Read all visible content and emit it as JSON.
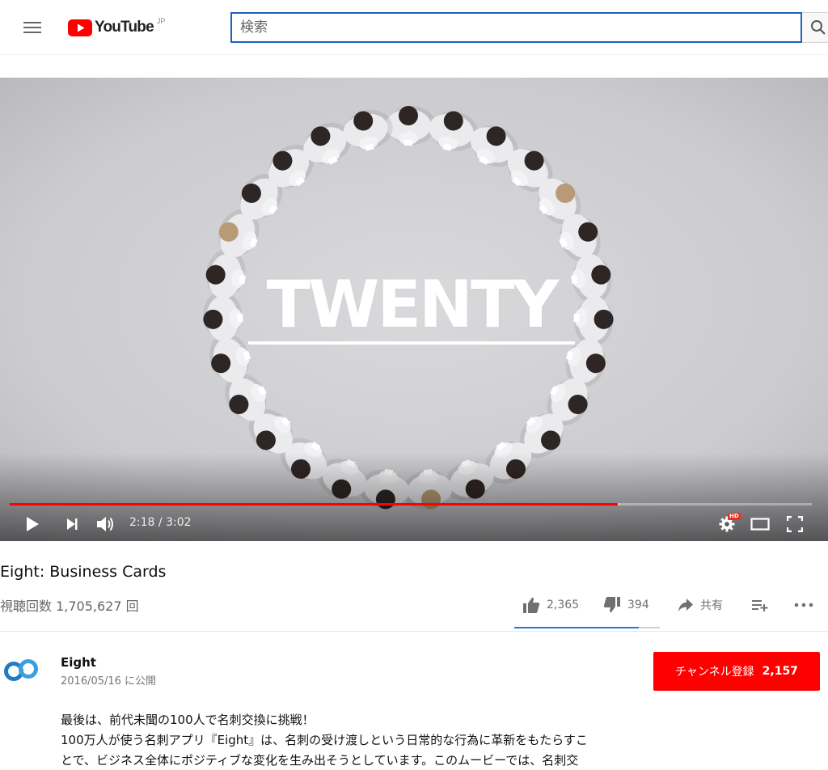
{
  "masthead": {
    "logo_text": "YouTube",
    "logo_country": "JP",
    "search_placeholder": "検索",
    "search_value": ""
  },
  "player": {
    "overlay_title": "TWENTY",
    "time_current": "2:18",
    "time_separator": " / ",
    "time_duration": "3:02",
    "progress_played_fraction": 0.758,
    "progress_loaded_fraction": 0.76,
    "hd_badge": "HD"
  },
  "video": {
    "title": "Eight: Business Cards",
    "view_count": "視聴回数 1,705,627 回"
  },
  "actions": {
    "likes": "2,365",
    "dislikes": "394",
    "share_label": "共有",
    "like_fraction": 0.857
  },
  "owner": {
    "name": "Eight",
    "publish_date": "2016/05/16 に公開",
    "subscribe_label": "チャンネル登録",
    "subscriber_count": "2,157"
  },
  "description": {
    "lines": [
      "最後は、前代未聞の100人で名刺交換に挑戦！",
      "100万人が使う名刺アプリ『Eight』は、名刺の受け渡しという日常的な行為に革新をもたらすこ",
      "とで、ビジネス全体にポジティブな変化を生み出そうとしています。このムービーでは、名刺交"
    ]
  },
  "icons": {
    "menu": "hamburger-menu-icon",
    "search": "search-icon",
    "play": "play-icon",
    "next": "next-icon",
    "volume": "volume-icon",
    "settings": "settings-gear-icon",
    "theater": "theater-mode-icon",
    "fullscreen": "fullscreen-icon",
    "like": "thumbs-up-icon",
    "dislike": "thumbs-down-icon",
    "share": "share-arrow-icon",
    "add_to": "add-to-playlist-icon",
    "more": "more-horizontal-icon"
  },
  "colors": {
    "brand_red": "#ff0000",
    "progress_red": "#ff0000",
    "search_border": "#1c62b9",
    "like_bar": "#1f7ad8"
  }
}
